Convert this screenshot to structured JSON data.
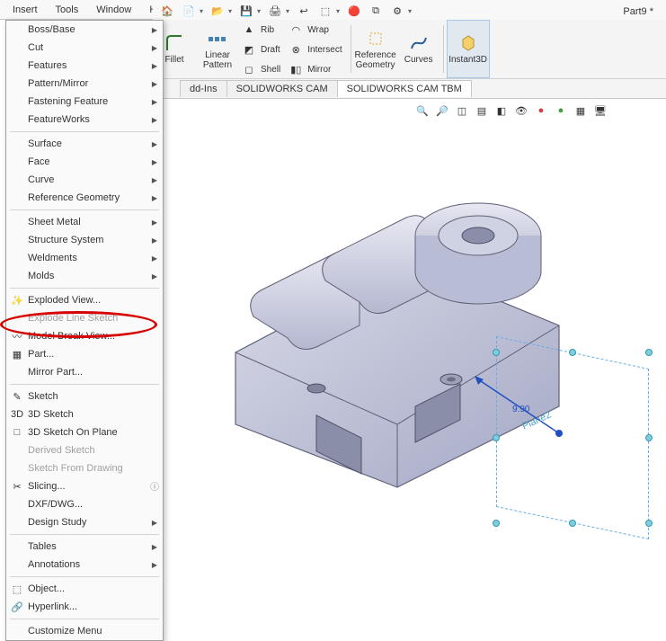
{
  "title": "Part9 *",
  "menubar": {
    "items": [
      "Insert",
      "Tools",
      "Window",
      "Help"
    ]
  },
  "ribbon": {
    "big": [
      {
        "label": "Fillet"
      },
      {
        "label": "Linear\nPattern"
      }
    ],
    "grid": [
      {
        "label": "Rib"
      },
      {
        "label": "Draft"
      },
      {
        "label": "Shell"
      },
      {
        "label": "Wrap"
      },
      {
        "label": "Intersect"
      },
      {
        "label": "Mirror"
      }
    ],
    "right": [
      {
        "label": "Reference\nGeometry"
      },
      {
        "label": "Curves"
      },
      {
        "label": "Instant3D"
      }
    ]
  },
  "tabs": [
    {
      "label": "dd-Ins",
      "active": false
    },
    {
      "label": "SOLIDWORKS CAM",
      "active": false
    },
    {
      "label": "SOLIDWORKS CAM TBM",
      "active": true
    }
  ],
  "insert_menu": {
    "groups": [
      [
        {
          "label": "Boss/Base",
          "sub": true
        },
        {
          "label": "Cut",
          "sub": true
        },
        {
          "label": "Features",
          "sub": true
        },
        {
          "label": "Pattern/Mirror",
          "sub": true
        },
        {
          "label": "Fastening Feature",
          "sub": true
        },
        {
          "label": "FeatureWorks",
          "sub": true
        }
      ],
      [
        {
          "label": "Surface",
          "sub": true
        },
        {
          "label": "Face",
          "sub": true
        },
        {
          "label": "Curve",
          "sub": true
        },
        {
          "label": "Reference Geometry",
          "sub": true
        }
      ],
      [
        {
          "label": "Sheet Metal",
          "sub": true
        },
        {
          "label": "Structure System",
          "sub": true
        },
        {
          "label": "Weldments",
          "sub": true
        },
        {
          "label": "Molds",
          "sub": true
        }
      ],
      [
        {
          "label": "Exploded View...",
          "icon": "exploded"
        },
        {
          "label": "Explode Line Sketch",
          "disabled": true
        },
        {
          "label": "Model Break View...",
          "icon": "break"
        },
        {
          "label": "Part...",
          "icon": "part"
        },
        {
          "label": "Mirror Part...",
          "highlight": true
        }
      ],
      [
        {
          "label": "Sketch",
          "icon": "sketch"
        },
        {
          "label": "3D Sketch",
          "icon": "sk3d"
        },
        {
          "label": "3D Sketch On Plane",
          "icon": "sk3dp"
        },
        {
          "label": "Derived Sketch",
          "disabled": true
        },
        {
          "label": "Sketch From Drawing",
          "disabled": true
        },
        {
          "label": "Slicing...",
          "icon": "slice",
          "help": true
        },
        {
          "label": "DXF/DWG..."
        },
        {
          "label": "Design Study",
          "sub": true
        }
      ],
      [
        {
          "label": "Tables",
          "sub": true
        },
        {
          "label": "Annotations",
          "sub": true
        }
      ],
      [
        {
          "label": "Object...",
          "icon": "obj"
        },
        {
          "label": "Hyperlink...",
          "icon": "link"
        }
      ],
      [
        {
          "label": "Customize Menu"
        }
      ]
    ]
  },
  "viewport": {
    "plane_label": "Plane2",
    "dim_label": "9.90"
  }
}
